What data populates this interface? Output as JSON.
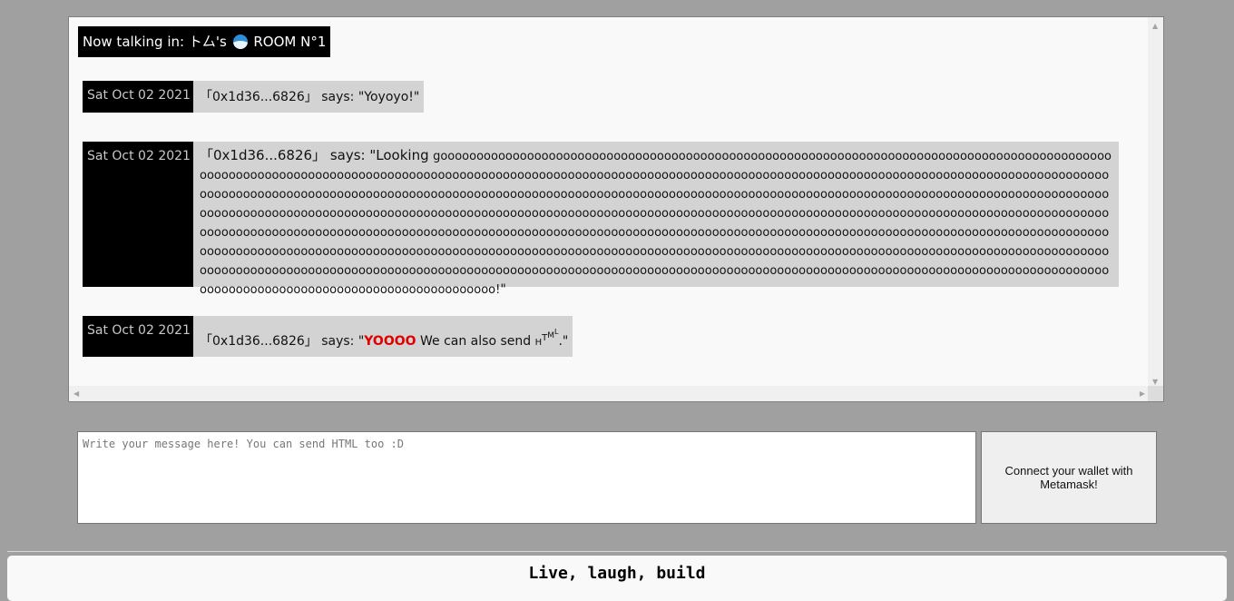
{
  "chat": {
    "header_label": "Now talking in:",
    "room_owner": "ト厶's",
    "room_icon": "wave-icon",
    "room_name": "ROOM N°1",
    "messages": [
      {
        "date": "Sat Oct 02 2021",
        "sender": "「0x1d36...6826」",
        "says": " says: \"",
        "text": "Yoyoyo!",
        "end": "\""
      },
      {
        "date": "Sat Oct 02 2021",
        "sender": "「0x1d36...6826」",
        "says": " says: \"",
        "text_first": "Looking",
        "text_long": "goooooooooooooooooooooooooooooooooooooooooooooooooooooooooooooooooooooooooooooooooooooooooooooooooooooooooooooooooooooooooooooooooooooooooooooooooooooooooooooooooooooooooooooooooooooooooooooooooooooooooooooooooooooooooooooooooooooooooooooooooooooooooooooooooooooooooooooooooooooooooooooooooooooooooooooooooooooooooooooooooooooooooooooooooooooooooooooooooooooooooooooooooooooooooooooooooooooooooooooooooooooooooooooooooooooooooooooooooooooooooooooooooooooooooooooooooooooooooooooooooooooooooooooooooooooooooooooooooooooooooooooooooooooooooooooooooooooooooooooooooooooooooooooooooooooooooooooooooooooooooooooooooooooooooooooooooooooooooooooooooooooooooooooooooooooooooooooooooooooooooooooooooooooooooooooooooooooooooooooooooooooooooooooooooooooooooooooooooooooooooooooooooooooooooooooooooooooooooooooooooooooooooooooooooooooooooooooooooooooooooooooooooooooooooooooooooooooooooooooooooooooooooo!",
        "end": "\""
      },
      {
        "date": "Sat Oct 02 2021",
        "sender": "「0x1d36...6826」",
        "says": " says: \"",
        "text_bold": "YOOOO",
        "text_rest": " We can also send ",
        "htm_h": "H",
        "htm_t": "T",
        "htm_m": "M",
        "htm_l": "L",
        "end": ".\""
      }
    ]
  },
  "composer": {
    "placeholder": "Write your message here! You can send HTML too :D",
    "value": "",
    "button_label": "Connect your wallet with Metamask!"
  },
  "footer": {
    "text": "Live, laugh, build"
  },
  "colors": {
    "page_bg": "#a0a0a0",
    "highlight": "#e00000",
    "date_bg": "#000000",
    "message_bg": "#d3d3d3"
  }
}
